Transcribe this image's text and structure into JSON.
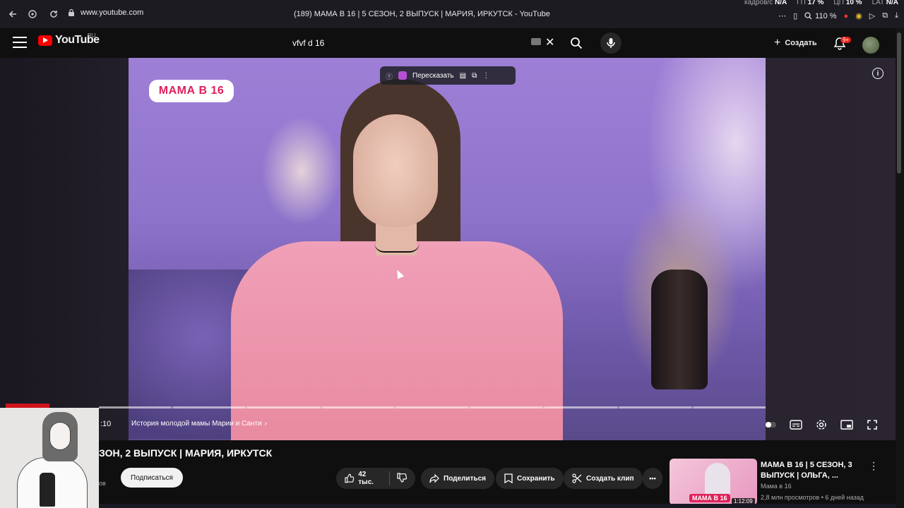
{
  "browser": {
    "url": "www.youtube.com",
    "tab_title": "(189) МАМА В 16 | 5 СЕЗОН, 2 ВЫПУСК | МАРИЯ, ИРКУТСК - YouTube",
    "zoom": "110 %",
    "stats": {
      "fps_label": "кадров/с",
      "fps_value": "N/A",
      "gpu_label": "ГП",
      "gpu_value": "17 %",
      "cpu_label": "ЦП",
      "cpu_value": "10 %",
      "lat_label": "LAT",
      "lat_value": "N/A"
    }
  },
  "header": {
    "logo_text": "YouTube",
    "region": "RU",
    "search_value": "vfvf d 16",
    "create_label": "Создать",
    "notifications": "9+"
  },
  "player": {
    "brand_tag": "МАМА В 16",
    "pip_label": "Пересказать",
    "time": ":10",
    "chapter": "История молодой мамы Марии и Санти",
    "chapter_chevron": "›"
  },
  "video": {
    "title": "ЗОН, 2 ВЫПУСК | МАРИЯ, ИРКУТСК",
    "subscribe_label": "Подписаться",
    "channel_subs": "ов",
    "likes": "42 тыс.",
    "share_label": "Поделиться",
    "save_label": "Сохранить",
    "clip_label": "Создать клип",
    "more_label": "•••"
  },
  "recommendation": {
    "title": "МАМА В 16 | 5 СЕЗОН, 3 ВЫПУСК | ОЛЬГА, ...",
    "channel": "Мама в 16",
    "meta": "2,8 млн просмотров • 6 дней назад",
    "duration": "1:12:09",
    "thumb_brand": "МАМА В 16"
  },
  "colors": {
    "brand_red": "#ff0000",
    "background": "#0f0f0f",
    "button_bg": "#272727",
    "accent_pink": "#e0215a"
  },
  "icons": [
    "back-icon",
    "shield-icon",
    "reload-icon",
    "lock-icon",
    "bookmark-icon",
    "search-icon",
    "mic-icon",
    "plus-icon",
    "bell-icon",
    "info-icon",
    "subtitles-icon",
    "settings-icon",
    "miniplayer-icon",
    "fullscreen-icon",
    "thumbs-up-icon",
    "thumbs-down-icon",
    "share-icon",
    "save-icon",
    "scissors-icon",
    "kebab-icon"
  ]
}
